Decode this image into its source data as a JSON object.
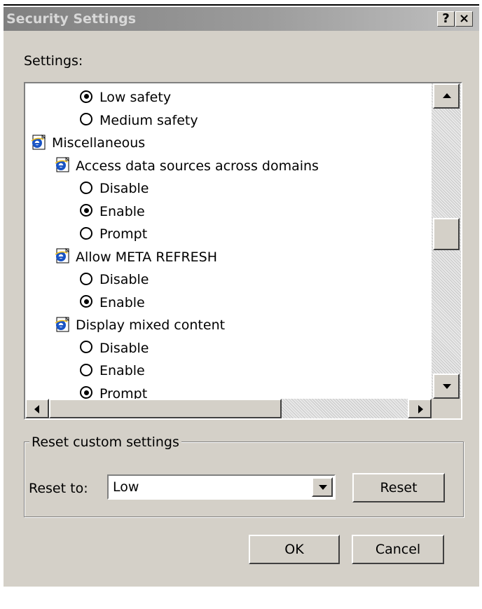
{
  "window": {
    "title": "Security Settings",
    "help_button": "?",
    "close_button": "×"
  },
  "settings_label": "Settings:",
  "tree": [
    {
      "kind": "radio",
      "label": "Low safety",
      "selected": true,
      "indent": 2
    },
    {
      "kind": "radio",
      "label": "Medium safety",
      "selected": false,
      "indent": 2
    },
    {
      "kind": "category",
      "label": "Miscellaneous",
      "indent": 0
    },
    {
      "kind": "setting",
      "label": "Access data sources across domains",
      "indent": 1
    },
    {
      "kind": "radio",
      "label": "Disable",
      "selected": false,
      "indent": 2
    },
    {
      "kind": "radio",
      "label": "Enable",
      "selected": true,
      "indent": 2
    },
    {
      "kind": "radio",
      "label": "Prompt",
      "selected": false,
      "indent": 2
    },
    {
      "kind": "setting",
      "label": "Allow META REFRESH",
      "indent": 1
    },
    {
      "kind": "radio",
      "label": "Disable",
      "selected": false,
      "indent": 2
    },
    {
      "kind": "radio",
      "label": "Enable",
      "selected": true,
      "indent": 2
    },
    {
      "kind": "setting",
      "label": "Display mixed content",
      "indent": 1
    },
    {
      "kind": "radio",
      "label": "Disable",
      "selected": false,
      "indent": 2
    },
    {
      "kind": "radio",
      "label": "Enable",
      "selected": false,
      "indent": 2
    },
    {
      "kind": "radio",
      "label": "Prompt",
      "selected": true,
      "indent": 2
    }
  ],
  "reset_group": {
    "label": "Reset custom settings",
    "reset_to_label": "Reset to:",
    "reset_to_value": "Low",
    "reset_button": "Reset"
  },
  "buttons": {
    "ok": "OK",
    "cancel": "Cancel"
  },
  "colors": {
    "dialog_bg": "#d4d0c8",
    "title_text": "#d8d8d8",
    "ie_icon_blue": "#1a54c4"
  }
}
